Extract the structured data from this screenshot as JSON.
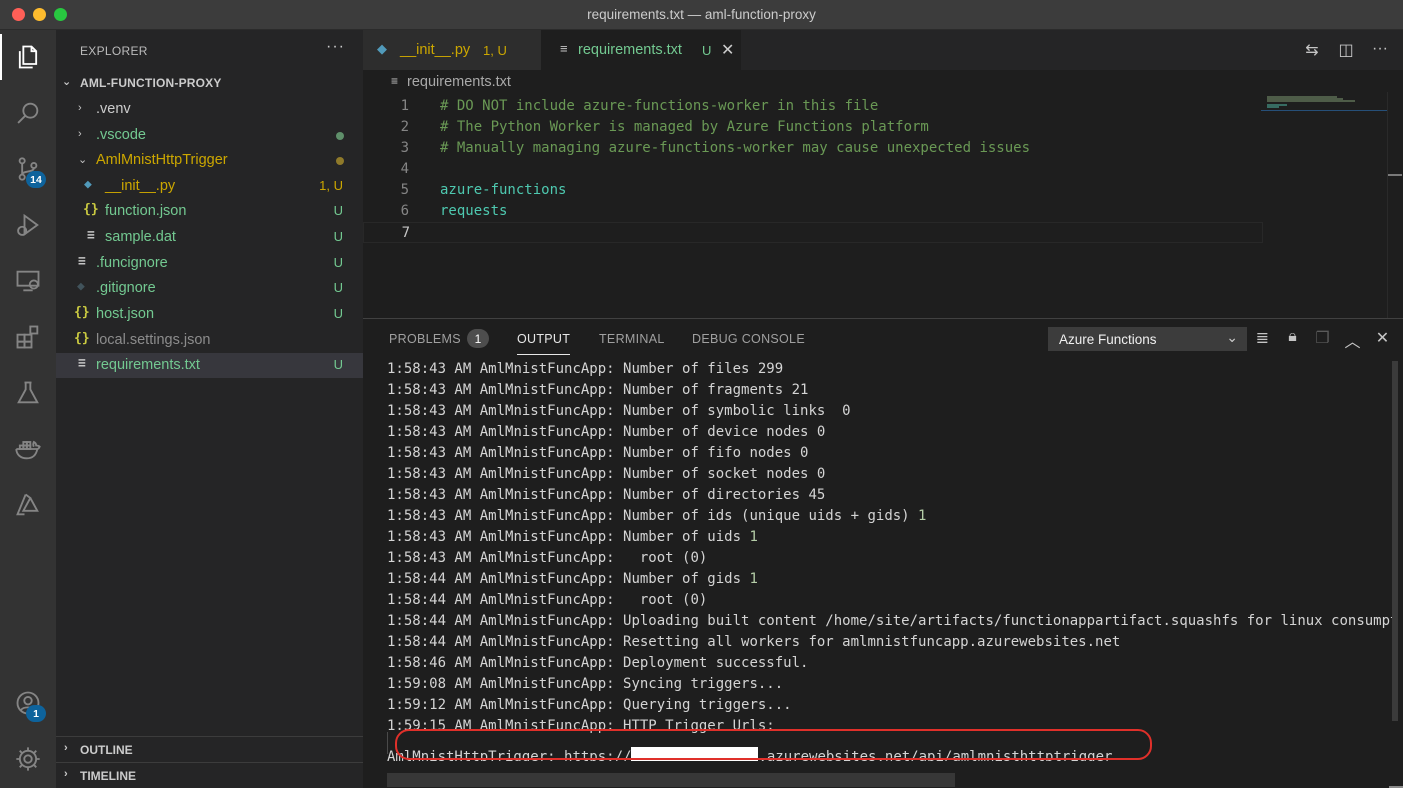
{
  "window": {
    "title": "requirements.txt — aml-function-proxy"
  },
  "activity_bar": {
    "items": [
      {
        "name": "explorer",
        "icon": "files-icon"
      },
      {
        "name": "search",
        "icon": "search-icon"
      },
      {
        "name": "source-control",
        "icon": "source-control-icon",
        "badge": "14"
      },
      {
        "name": "run-debug",
        "icon": "run-debug-icon"
      },
      {
        "name": "remote-explorer",
        "icon": "remote-explorer-icon"
      },
      {
        "name": "extensions",
        "icon": "extensions-icon"
      },
      {
        "name": "testing",
        "icon": "flask-icon"
      },
      {
        "name": "docker",
        "icon": "docker-icon"
      },
      {
        "name": "azure",
        "icon": "azure-icon"
      }
    ],
    "bottom": [
      {
        "name": "accounts",
        "icon": "account-icon",
        "badge": "1"
      },
      {
        "name": "manage",
        "icon": "gear-icon"
      }
    ]
  },
  "sidebar": {
    "header": "EXPLORER",
    "more": "···",
    "root": "AML-FUNCTION-PROXY",
    "items": [
      {
        "label": ".venv",
        "type": "folder",
        "decoration": ""
      },
      {
        "label": ".vscode",
        "type": "folder",
        "decoration": "dot"
      },
      {
        "label": "AmlMnistHttpTrigger",
        "type": "folder-open",
        "decoration": "dot"
      },
      {
        "label": "__init__.py",
        "type": "file",
        "decoration": "1, U"
      },
      {
        "label": "function.json",
        "type": "file",
        "decoration": "U"
      },
      {
        "label": "sample.dat",
        "type": "file",
        "decoration": "U"
      },
      {
        "label": ".funcignore",
        "type": "file",
        "decoration": "U"
      },
      {
        "label": ".gitignore",
        "type": "file",
        "decoration": "U"
      },
      {
        "label": "host.json",
        "type": "file",
        "decoration": "U"
      },
      {
        "label": "local.settings.json",
        "type": "file",
        "decoration": ""
      },
      {
        "label": "requirements.txt",
        "type": "file",
        "decoration": "U"
      }
    ],
    "outline": "OUTLINE",
    "timeline": "TIMELINE"
  },
  "editor": {
    "tabs": [
      {
        "label": "__init__.py",
        "status": "1, U"
      },
      {
        "label": "requirements.txt",
        "status": "U"
      }
    ],
    "breadcrumb": "requirements.txt",
    "lines": [
      {
        "n": "1",
        "text": "# DO NOT include azure-functions-worker in this file"
      },
      {
        "n": "2",
        "text": "# The Python Worker is managed by Azure Functions platform"
      },
      {
        "n": "3",
        "text": "# Manually managing azure-functions-worker may cause unexpected issues"
      },
      {
        "n": "4",
        "text": ""
      },
      {
        "n": "5",
        "text": "azure-functions"
      },
      {
        "n": "6",
        "text": "requests"
      },
      {
        "n": "7",
        "text": ""
      }
    ]
  },
  "panel": {
    "tabs": {
      "problems": "PROBLEMS",
      "problems_count": "1",
      "output": "OUTPUT",
      "terminal": "TERMINAL",
      "debug_console": "DEBUG CONSOLE"
    },
    "channel": "Azure Functions",
    "output_lines": [
      {
        "time": "1:58:43 AM",
        "text": "AmlMnistFuncApp: Number of files 299"
      },
      {
        "time": "1:58:43 AM",
        "text": "AmlMnistFuncApp: Number of fragments 21"
      },
      {
        "time": "1:58:43 AM",
        "text": "AmlMnistFuncApp: Number of symbolic links  0"
      },
      {
        "time": "1:58:43 AM",
        "text": "AmlMnistFuncApp: Number of device nodes 0"
      },
      {
        "time": "1:58:43 AM",
        "text": "AmlMnistFuncApp: Number of fifo nodes 0"
      },
      {
        "time": "1:58:43 AM",
        "text": "AmlMnistFuncApp: Number of socket nodes 0"
      },
      {
        "time": "1:58:43 AM",
        "text": "AmlMnistFuncApp: Number of directories 45"
      },
      {
        "time": "1:58:43 AM",
        "text": "AmlMnistFuncApp: Number of ids (unique uids + gids) 1"
      },
      {
        "time": "1:58:43 AM",
        "text": "AmlMnistFuncApp: Number of uids 1"
      },
      {
        "time": "1:58:43 AM",
        "text": "AmlMnistFuncApp:   root (0)"
      },
      {
        "time": "1:58:44 AM",
        "text": "AmlMnistFuncApp: Number of gids 1"
      },
      {
        "time": "1:58:44 AM",
        "text": "AmlMnistFuncApp:   root (0)"
      },
      {
        "time": "1:58:44 AM",
        "text": "AmlMnistFuncApp: Uploading built content /home/site/artifacts/functionappartifact.squashfs for linux consumpti"
      },
      {
        "time": "1:58:44 AM",
        "text": "AmlMnistFuncApp: Resetting all workers for amlmnistfuncapp.azurewebsites.net"
      },
      {
        "time": "1:58:46 AM",
        "text": "AmlMnistFuncApp: Deployment successful."
      },
      {
        "time": "1:59:08 AM",
        "text": "AmlMnistFuncApp: Syncing triggers..."
      },
      {
        "time": "1:59:12 AM",
        "text": "AmlMnistFuncApp: Querying triggers..."
      },
      {
        "time": "1:59:15 AM",
        "text": "AmlMnistFuncApp: HTTP Trigger Urls:"
      }
    ],
    "trigger": {
      "label": "AmlMnistHttpTrigger:",
      "url_prefix": "https://",
      "url_suffix": ".azurewebsites.net/api/amlmnisthttptrigger"
    }
  },
  "colors": {
    "accent": "#0e639c",
    "untracked": "#73c991",
    "modified": "#cca700",
    "highlight": "#e0302a"
  }
}
